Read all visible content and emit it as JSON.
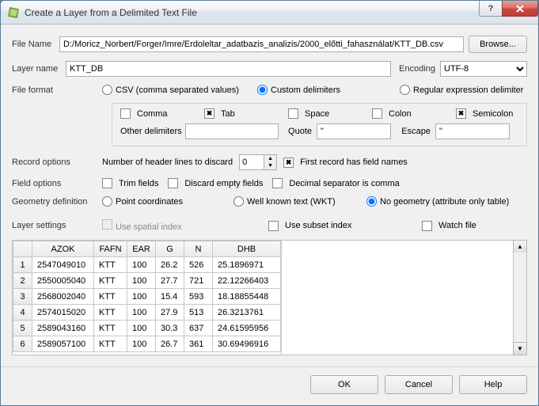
{
  "window": {
    "title": "Create a Layer from a Delimited Text File"
  },
  "filename": {
    "label": "File Name",
    "value": "D:/Moricz_Norbert/Forger/Imre/Erdoleltar_adatbazis_analizis/2000_előtti_fahasználat/KTT_DB.csv",
    "browse": "Browse..."
  },
  "layername": {
    "label": "Layer name",
    "value": "KTT_DB",
    "encoding_label": "Encoding",
    "encoding_value": "UTF-8"
  },
  "fileformat": {
    "label": "File format",
    "csv": "CSV (comma separated values)",
    "custom": "Custom delimiters",
    "regex": "Regular expression delimiter"
  },
  "delim": {
    "comma": "Comma",
    "tab": "Tab",
    "space": "Space",
    "colon": "Colon",
    "semicolon": "Semicolon",
    "other_label": "Other delimiters",
    "other_value": "",
    "quote_label": "Quote",
    "quote_value": "\"",
    "escape_label": "Escape",
    "escape_value": "\""
  },
  "record": {
    "label": "Record options",
    "discard_label": "Number of header lines to discard",
    "discard_value": "0",
    "firstrec": "First record has field names"
  },
  "fieldopts": {
    "label": "Field options",
    "trim": "Trim fields",
    "empty": "Discard empty fields",
    "decimal": "Decimal separator is comma"
  },
  "geom": {
    "label": "Geometry definition",
    "point": "Point coordinates",
    "wkt": "Well known text (WKT)",
    "none": "No geometry (attribute only table)"
  },
  "layerset": {
    "label": "Layer settings",
    "spatial": "Use spatial index",
    "subset": "Use subset index",
    "watch": "Watch file"
  },
  "table": {
    "headers": [
      "AZOK",
      "FAFN",
      "EAR",
      "G",
      "N",
      "DHB"
    ],
    "rows": [
      [
        "2547049010",
        "KTT",
        "100",
        "26.2",
        "526",
        "25.1896971"
      ],
      [
        "2550005040",
        "KTT",
        "100",
        "27.7",
        "721",
        "22.12266403"
      ],
      [
        "2568002040",
        "KTT",
        "100",
        "15.4",
        "593",
        "18.18855448"
      ],
      [
        "2574015020",
        "KTT",
        "100",
        "27.9",
        "513",
        "26.3213761"
      ],
      [
        "2589043160",
        "KTT",
        "100",
        "30.3",
        "637",
        "24.61595956"
      ],
      [
        "2589057100",
        "KTT",
        "100",
        "26.7",
        "361",
        "30.69496916"
      ]
    ]
  },
  "buttons": {
    "ok": "OK",
    "cancel": "Cancel",
    "help": "Help"
  },
  "chart_data": {
    "type": "table",
    "title": "Delimited text preview",
    "headers": [
      "AZOK",
      "FAFN",
      "EAR",
      "G",
      "N",
      "DHB"
    ],
    "rows": [
      [
        "2547049010",
        "KTT",
        100,
        26.2,
        526,
        25.1896971
      ],
      [
        "2550005040",
        "KTT",
        100,
        27.7,
        721,
        22.12266403
      ],
      [
        "2568002040",
        "KTT",
        100,
        15.4,
        593,
        18.18855448
      ],
      [
        "2574015020",
        "KTT",
        100,
        27.9,
        513,
        26.3213761
      ],
      [
        "2589043160",
        "KTT",
        100,
        30.3,
        637,
        24.61595956
      ],
      [
        "2589057100",
        "KTT",
        100,
        26.7,
        361,
        30.69496916
      ]
    ]
  }
}
